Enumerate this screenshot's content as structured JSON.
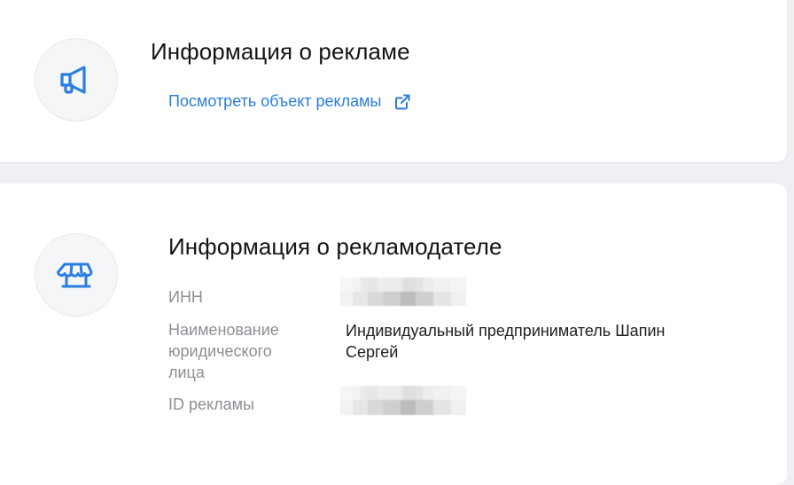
{
  "ad_info": {
    "title": "Информация о рекламе",
    "link_label": "Посмотреть объект рекламы",
    "icon": "megaphone-icon",
    "link_icon": "external-link-icon"
  },
  "advertiser_info": {
    "title": "Информация о рекламодателе",
    "icon": "storefront-icon",
    "fields": {
      "inn": {
        "label": "ИНН"
      },
      "name": {
        "label_line1": "Наименование",
        "label_line2": "юридического",
        "label_line3": "лица",
        "value_line1": "Индивидуальный предприниматель Шапин",
        "value_line2": "Сергей"
      },
      "ad_id": {
        "label": "ID рекламы"
      }
    }
  },
  "colors": {
    "accent": "#2a7de1",
    "background": "#eef0f3",
    "card": "#ffffff",
    "label": "#8b8f96"
  }
}
